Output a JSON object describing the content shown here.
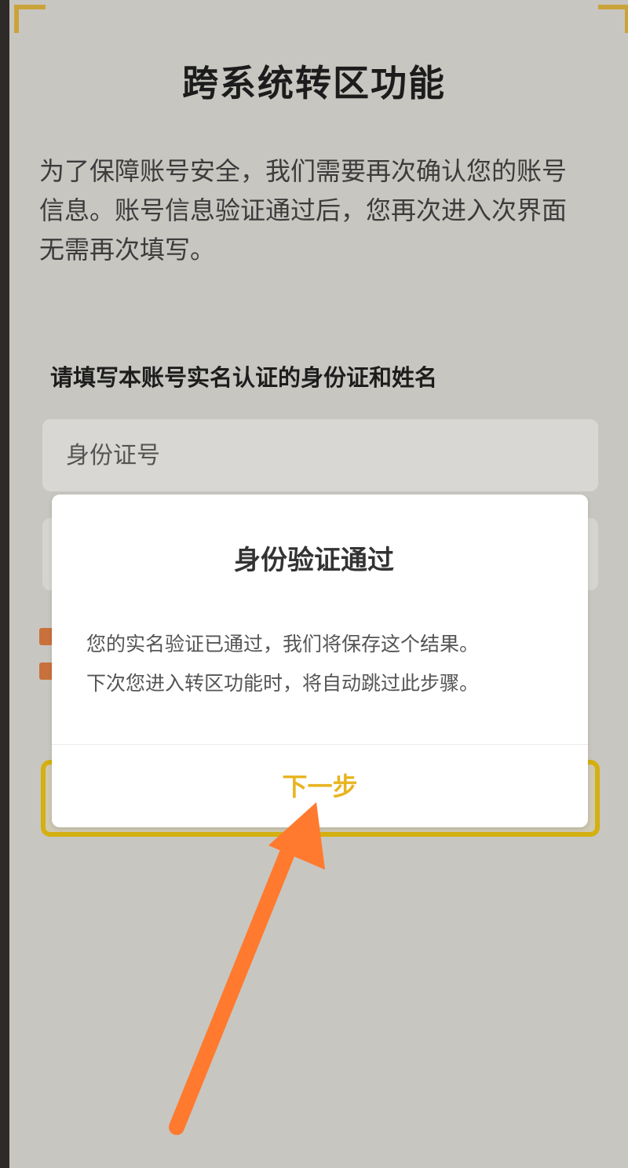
{
  "page": {
    "title": "跨系统转区功能",
    "intro_line1": "为了保障账号安全，我们需要再次确认您的账号",
    "intro_line2": "信息。账号信息验证通过后，您再次进入次界面",
    "intro_line3": "无需再次填写。",
    "form_label": "请填写本账号实名认证的身份证和姓名",
    "id_input_placeholder": "身份证号"
  },
  "dialog": {
    "title": "身份验证通过",
    "body_line1": "您的实名验证已通过，我们将保存这个结果。",
    "body_line2": "下次您进入转区功能时，将自动跳过此步骤。",
    "next_label": "下一步"
  },
  "colors": {
    "background": "#c8c6c1",
    "accent_yellow": "#e8b421",
    "annotation_arrow": "#ff7a2e"
  },
  "icons": {
    "annotation": "arrow-up-icon"
  }
}
